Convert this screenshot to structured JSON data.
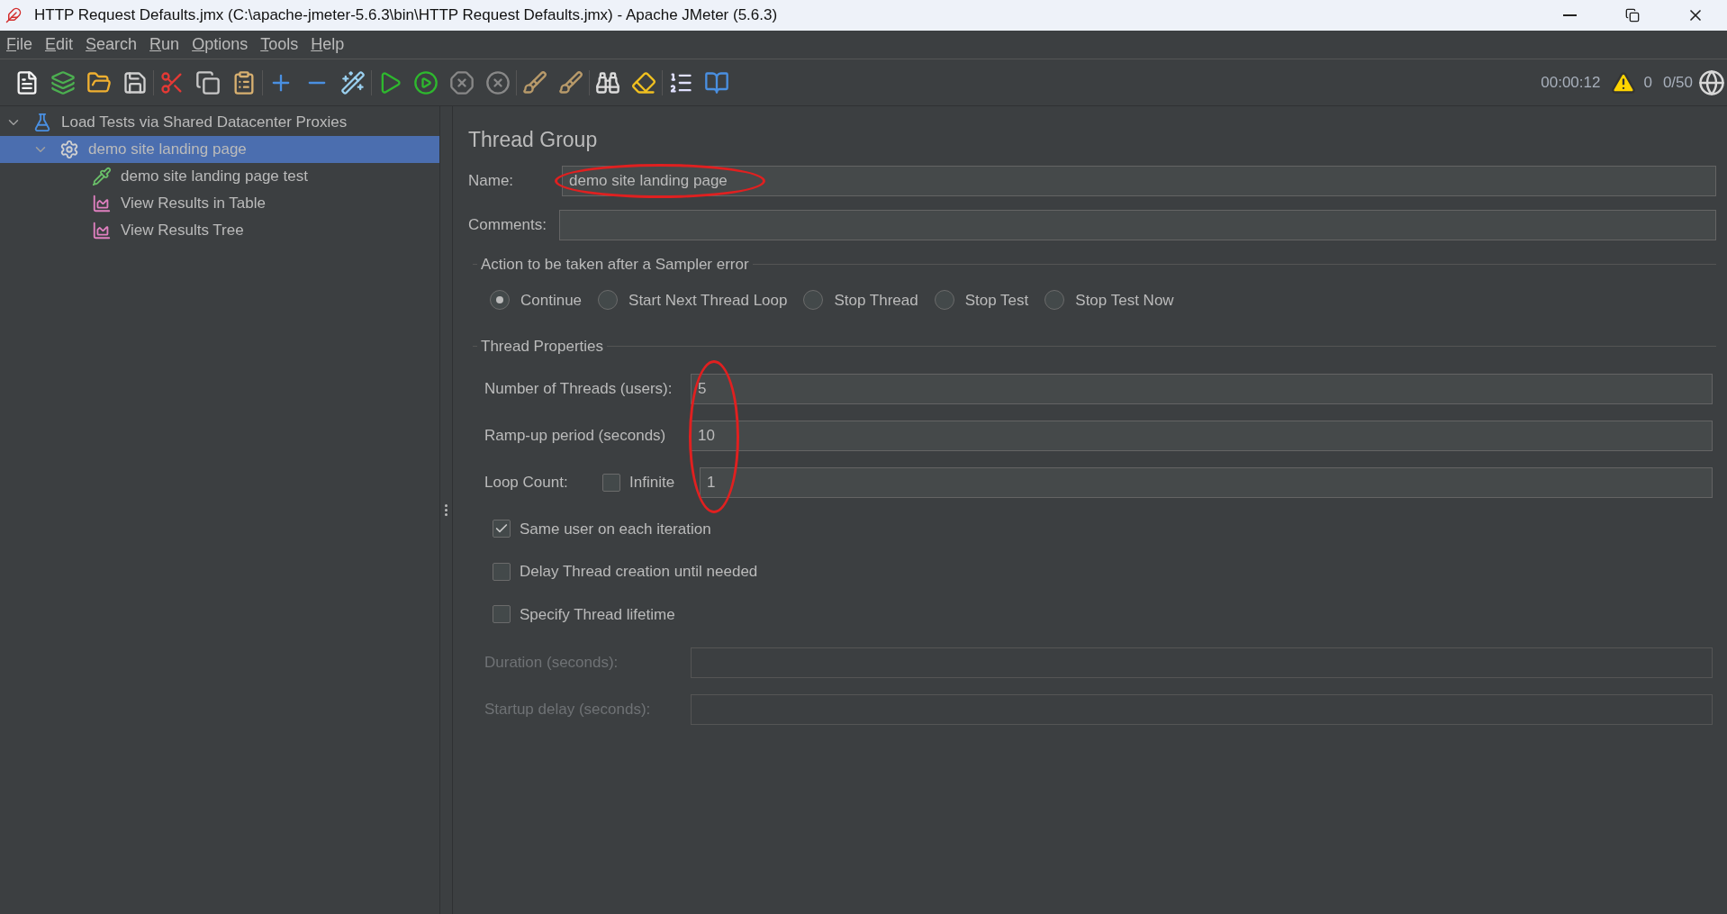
{
  "window": {
    "title": "HTTP Request Defaults.jmx (C:\\apache-jmeter-5.6.3\\bin\\HTTP Request Defaults.jmx) - Apache JMeter (5.6.3)"
  },
  "menu": [
    "File",
    "Edit",
    "Search",
    "Run",
    "Options",
    "Tools",
    "Help"
  ],
  "status": {
    "elapsed": "00:00:12",
    "warnings": "0",
    "threads": "0/50"
  },
  "tree": [
    {
      "label": "Load Tests via Shared Datacenter Proxies",
      "kind": "test-plan",
      "expanded": true,
      "selected": false,
      "children": [
        {
          "label": "demo site landing page",
          "kind": "thread-group",
          "expanded": true,
          "selected": true,
          "children": [
            {
              "label": "demo site landing page test",
              "kind": "sampler",
              "selected": false
            },
            {
              "label": "View Results in Table",
              "kind": "listener",
              "selected": false
            },
            {
              "label": "View Results Tree",
              "kind": "listener",
              "selected": false
            }
          ]
        }
      ]
    }
  ],
  "panel": {
    "title": "Thread Group",
    "name": {
      "label": "Name:",
      "value": "demo site landing page"
    },
    "comments": {
      "label": "Comments:"
    },
    "error_action": {
      "title": "Action to be taken after a Sampler error",
      "options": [
        {
          "label": "Continue",
          "selected": true
        },
        {
          "label": "Start Next Thread Loop",
          "selected": false
        },
        {
          "label": "Stop Thread",
          "selected": false
        },
        {
          "label": "Stop Test",
          "selected": false
        },
        {
          "label": "Stop Test Now",
          "selected": false
        }
      ]
    },
    "thread_properties": {
      "title": "Thread Properties",
      "threads": {
        "label": "Number of Threads (users):",
        "value": "5"
      },
      "ramp_up": {
        "label": "Ramp-up period (seconds)",
        "value": "10"
      },
      "loop_count": {
        "label": "Loop Count:",
        "infinite_label": "Infinite",
        "infinite": false,
        "value": "1"
      },
      "checkboxes": [
        {
          "label": "Same user on each iteration",
          "checked": true
        },
        {
          "label": "Delay Thread creation until needed",
          "checked": false
        },
        {
          "label": "Specify Thread lifetime",
          "checked": false
        }
      ],
      "lifetime_fields": [
        {
          "label": "Duration (seconds):",
          "disabled": true
        },
        {
          "label": "Startup delay (seconds):",
          "disabled": true
        }
      ]
    }
  }
}
